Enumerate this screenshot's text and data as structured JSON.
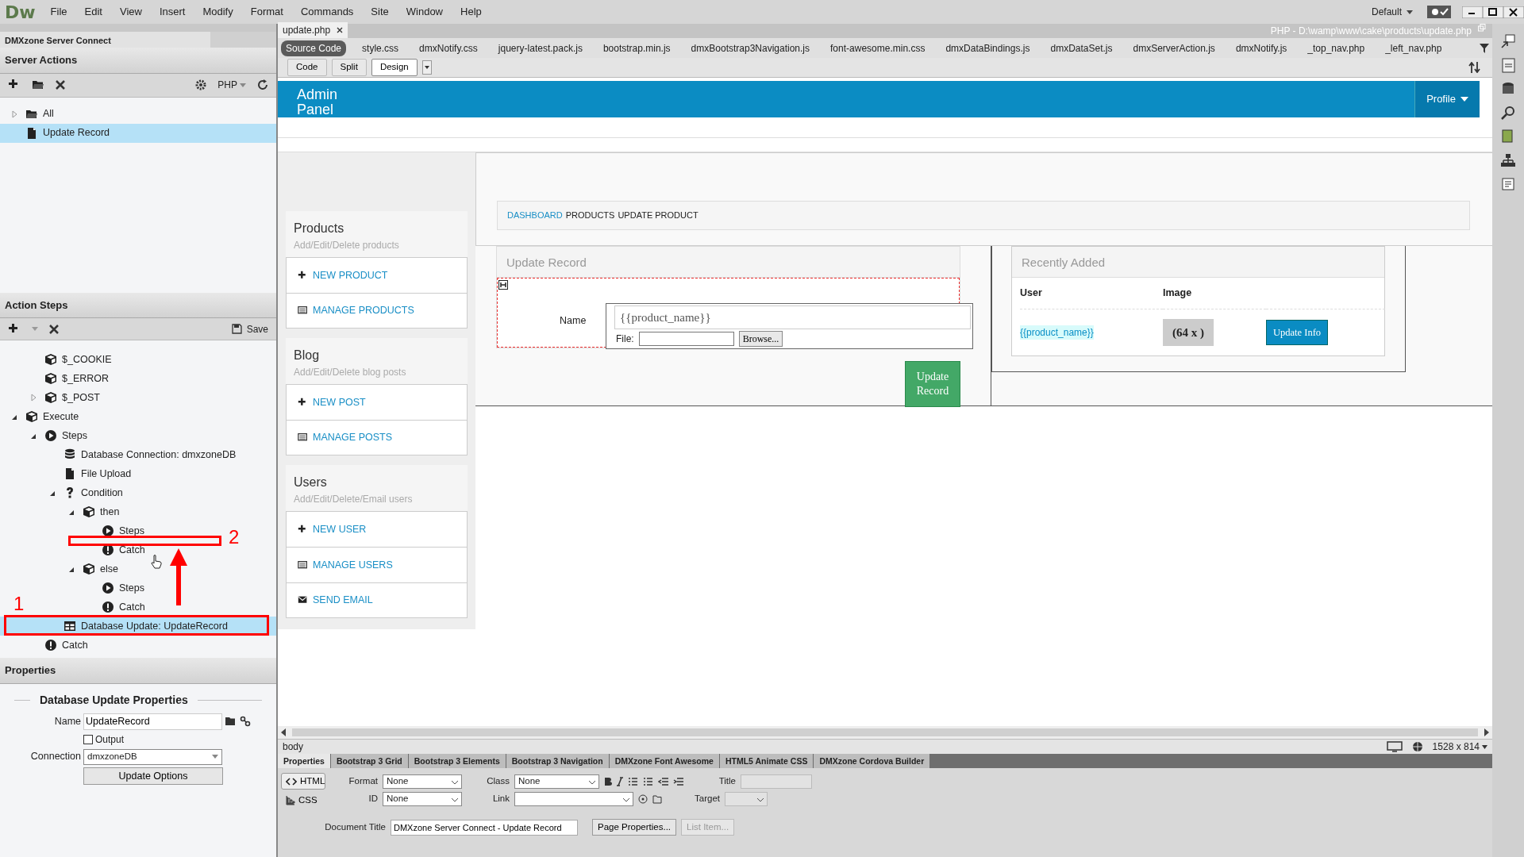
{
  "app": {
    "logo": "Dw",
    "menu": [
      "File",
      "Edit",
      "View",
      "Insert",
      "Modify",
      "Format",
      "Commands",
      "Site",
      "Window",
      "Help"
    ],
    "workspace": "Default"
  },
  "left_panel": {
    "tab": "DMXzone Server Connect",
    "server_actions": {
      "title": "Server Actions",
      "language": "PHP",
      "tree": [
        {
          "label": "All",
          "kind": "folder",
          "expanded": false,
          "selected": false
        },
        {
          "label": "Update Record",
          "kind": "file",
          "selected": true
        }
      ]
    },
    "action_steps": {
      "title": "Action Steps",
      "save": "Save",
      "tree": [
        {
          "children": [
            {
              "label": "$_COOKIE",
              "kind": "cube",
              "selected": false
            },
            {
              "label": "$_ERROR",
              "kind": "cube",
              "selected": false
            },
            {
              "label": "$_POST",
              "kind": "cube",
              "expanded": false,
              "selected": false
            }
          ]
        },
        {
          "label": "Execute",
          "kind": "cube",
          "expanded": true,
          "selected": false,
          "children": [
            {
              "label": "Steps",
              "kind": "play",
              "expanded": true,
              "selected": false,
              "children": [
                {
                  "label": "Database Connection: dmxzoneDB",
                  "kind": "database",
                  "selected": false
                },
                {
                  "label": "File Upload",
                  "kind": "file",
                  "selected": false
                },
                {
                  "label": "Condition",
                  "kind": "question",
                  "expanded": true,
                  "selected": false,
                  "children": [
                    {
                      "label": "then",
                      "kind": "cube",
                      "expanded": true,
                      "selected": false,
                      "children": [
                        {
                          "label": "Steps",
                          "kind": "play",
                          "selected": false
                        },
                        {
                          "label": "Catch",
                          "kind": "alert",
                          "selected": false
                        }
                      ]
                    },
                    {
                      "label": "else",
                      "kind": "cube",
                      "expanded": true,
                      "selected": false,
                      "children": [
                        {
                          "label": "Steps",
                          "kind": "play",
                          "selected": false
                        },
                        {
                          "label": "Catch",
                          "kind": "alert",
                          "selected": false
                        }
                      ]
                    }
                  ]
                },
                {
                  "label": "Database Update: UpdateRecord",
                  "kind": "table",
                  "selected": true
                }
              ]
            },
            {
              "label": "Catch",
              "kind": "alert",
              "selected": false
            }
          ]
        }
      ]
    },
    "annotations": [
      {
        "kind": "box"
      },
      {
        "kind": "box"
      },
      {
        "kind": "number",
        "label": "1"
      },
      {
        "kind": "number",
        "label": "2"
      },
      {
        "kind": "arrow"
      }
    ],
    "properties": {
      "title": "Properties",
      "heading": "Database Update Properties",
      "name_label": "Name",
      "name_value": "UpdateRecord",
      "output_label": "Output",
      "output_checked": false,
      "connection_label": "Connection",
      "connection_value": "dmxzoneDB",
      "button": "Update Options"
    }
  },
  "document": {
    "tab": "update.php",
    "path": "PHP - D:\\wamp\\www\\cake\\products\\update.php",
    "related_files": [
      {
        "label": "Source Code",
        "selected": true
      },
      {
        "label": "style.css",
        "selected": false
      },
      {
        "label": "dmxNotify.css",
        "selected": false
      },
      {
        "label": "jquery-latest.pack.js",
        "selected": false
      },
      {
        "label": "bootstrap.min.js",
        "selected": false
      },
      {
        "label": "dmxBootstrap3Navigation.js",
        "selected": false
      },
      {
        "label": "font-awesome.min.css",
        "selected": false
      },
      {
        "label": "dmxDataBindings.js",
        "selected": false
      },
      {
        "label": "dmxDataSet.js",
        "selected": false
      },
      {
        "label": "dmxServerAction.js",
        "selected": false
      },
      {
        "label": "dmxNotify.js",
        "selected": false
      },
      {
        "label": "_top_nav.php",
        "selected": false
      },
      {
        "label": "_left_nav.php",
        "selected": false
      }
    ],
    "views": [
      {
        "label": "Code",
        "selected": false
      },
      {
        "label": "Split",
        "selected": false
      },
      {
        "label": "Design",
        "selected": true
      }
    ]
  },
  "page": {
    "brand": "Admin Panel",
    "profile": "Profile",
    "sections": [
      {
        "title": "Products",
        "subtitle": "Add/Edit/Delete products",
        "items": [
          {
            "kind": "plus",
            "label": "NEW PRODUCT"
          },
          {
            "kind": "list",
            "label": "MANAGE PRODUCTS"
          }
        ]
      },
      {
        "title": "Blog",
        "subtitle": "Add/Edit/Delete blog posts",
        "items": [
          {
            "kind": "plus",
            "label": "NEW POST"
          },
          {
            "kind": "list",
            "label": "MANAGE POSTS"
          }
        ]
      },
      {
        "title": "Users",
        "subtitle": "Add/Edit/Delete/Email users",
        "items": [
          {
            "kind": "plus",
            "label": "NEW USER"
          },
          {
            "kind": "list",
            "label": "MANAGE USERS"
          },
          {
            "kind": "mail",
            "label": "SEND EMAIL"
          }
        ]
      }
    ],
    "breadcrumb": [
      {
        "label": "DASHBOARD",
        "link": true
      },
      {
        "label": "PRODUCTS",
        "link": false
      },
      {
        "label": "UPDATE PRODUCT",
        "link": false
      }
    ],
    "form": {
      "title": "Update Record",
      "name_label": "Name",
      "name_value": "{{product_name}}",
      "file_label": "File:",
      "browse": "Browse...",
      "submit": "Update Record"
    },
    "recent": {
      "title": "Recently Added",
      "columns": [
        "User",
        "Image"
      ],
      "row": {
        "user": "{{product_name}}",
        "image": "(64 x )",
        "action": "Update Info"
      }
    }
  },
  "status_bar": {
    "tag": "body",
    "size": "1528 x 814"
  },
  "inspector": {
    "tabs": [
      {
        "label": "Properties",
        "selected": true
      },
      {
        "label": "Bootstrap 3 Grid",
        "selected": false
      },
      {
        "label": "Bootstrap 3 Elements",
        "selected": false
      },
      {
        "label": "Bootstrap 3 Navigation",
        "selected": false
      },
      {
        "label": "DMXzone Font Awesome",
        "selected": false
      },
      {
        "label": "HTML5 Animate CSS",
        "selected": false
      },
      {
        "label": "DMXzone Cordova Builder",
        "selected": false
      }
    ],
    "modes": [
      {
        "label": "HTML",
        "selected": true
      },
      {
        "label": "CSS",
        "selected": false
      }
    ],
    "format_label": "Format",
    "format_value": "None",
    "class_label": "Class",
    "class_value": "None",
    "id_label": "ID",
    "id_value": "None",
    "link_label": "Link",
    "title_label": "Title",
    "target_label": "Target",
    "doc_title_label": "Document Title",
    "doc_title_value": "DMXzone Server Connect - Update Record",
    "buttons": [
      {
        "label": "Page Properties...",
        "disabled": false
      },
      {
        "label": "List Item...",
        "disabled": true
      }
    ]
  }
}
